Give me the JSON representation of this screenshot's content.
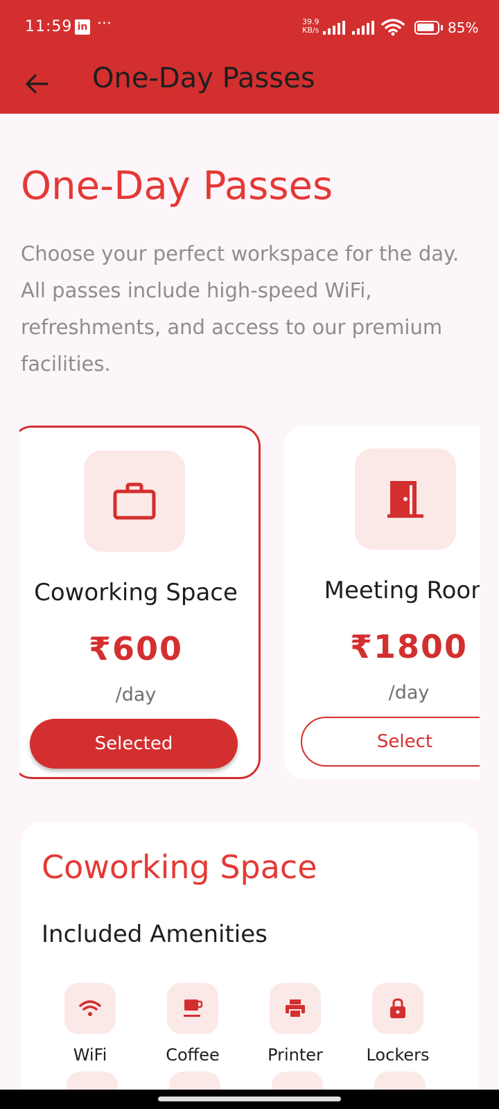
{
  "status_bar": {
    "time": "11:59",
    "linkedin_glyph": "in",
    "more": "···",
    "net_speed_value": "39.9",
    "net_speed_unit": "KB/s",
    "battery": "85%",
    "icons": [
      "linkedin-icon",
      "signal-icon",
      "wifi-icon",
      "battery-icon"
    ]
  },
  "app_bar": {
    "title": "One-Day Passes",
    "back_icon": "arrow-left-icon"
  },
  "header": {
    "heading": "One-Day Passes",
    "description": "Choose your perfect workspace for the day. All passes include high-speed WiFi, refreshments, and access to our premium facilities."
  },
  "passes": [
    {
      "name": "Coworking Space",
      "price": "₹600",
      "unit": "/day",
      "button": "Selected",
      "selected": true,
      "icon": "briefcase-icon"
    },
    {
      "name": "Meeting Room",
      "price": "₹1800",
      "unit": "/day",
      "button": "Select",
      "selected": false,
      "icon": "door-icon"
    }
  ],
  "detail": {
    "title": "Coworking Space",
    "subtitle": "Included Amenities",
    "amenities": [
      {
        "label": "WiFi",
        "icon": "wifi-icon"
      },
      {
        "label": "Coffee",
        "icon": "coffee-icon"
      },
      {
        "label": "Printer",
        "icon": "printer-icon"
      },
      {
        "label": "Lockers",
        "icon": "lock-icon"
      }
    ]
  },
  "colors": {
    "primary": "#d32f2f",
    "accent_text": "#e53935",
    "icon_bg": "#fbe9e7",
    "page_bg": "#fcf6fa"
  }
}
